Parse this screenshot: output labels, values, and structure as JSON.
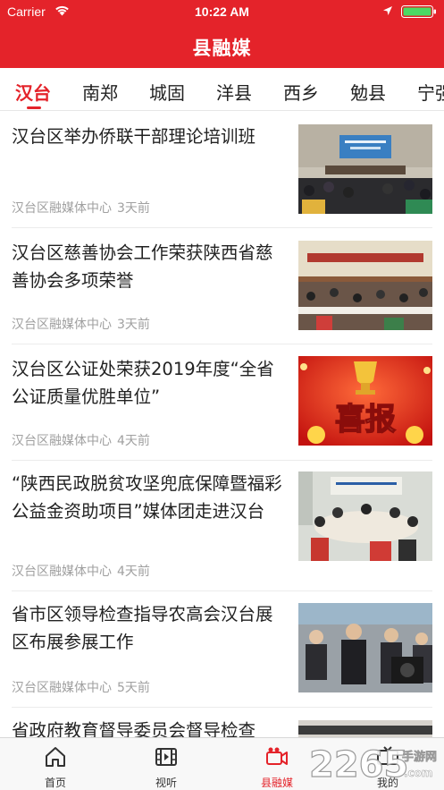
{
  "status_bar": {
    "carrier": "Carrier",
    "time": "10:22 AM"
  },
  "header": {
    "title": "县融媒"
  },
  "tabs": [
    {
      "label": "汉台",
      "active": true
    },
    {
      "label": "南郑",
      "active": false
    },
    {
      "label": "城固",
      "active": false
    },
    {
      "label": "洋县",
      "active": false
    },
    {
      "label": "西乡",
      "active": false
    },
    {
      "label": "勉县",
      "active": false
    },
    {
      "label": "宁强",
      "active": false
    }
  ],
  "news": [
    {
      "title": "汉台区举办侨联干部理论培训班",
      "source": "汉台区融媒体中心",
      "time": "3天前",
      "thumb": "meeting-hall-photo"
    },
    {
      "title": "汉台区慈善协会工作荣获陕西省慈善协会多项荣誉",
      "source": "汉台区融媒体中心",
      "time": "3天前",
      "thumb": "conference-photo"
    },
    {
      "title": "汉台区公证处荣获2019年度“全省公证质量优胜单位”",
      "source": "汉台区融媒体中心",
      "time": "4天前",
      "thumb": "xibao-banner",
      "thumb_text": "喜报"
    },
    {
      "title": "“陕西民政脱贫攻坚兜底保障暨福彩公益金资助项目”媒体团走进汉台",
      "source": "汉台区融媒体中心",
      "time": "4天前",
      "thumb": "round-table-meeting-photo"
    },
    {
      "title": "省市区领导检查指导农高会汉台展区布展参展工作",
      "source": "汉台区融媒体中心",
      "time": "5天前",
      "thumb": "officials-inspection-photo"
    },
    {
      "title": "省政府教育督导委员会督导检查",
      "source": "",
      "time": "",
      "thumb": "partial-photo"
    }
  ],
  "tabbar": [
    {
      "label": "首页",
      "icon": "home-icon",
      "active": false
    },
    {
      "label": "视听",
      "icon": "film-icon",
      "active": false
    },
    {
      "label": "县融媒",
      "icon": "camera-icon",
      "active": true
    },
    {
      "label": "我的",
      "icon": "tv-icon",
      "active": false
    }
  ],
  "watermark": {
    "number": "2265",
    "brand": "手游网",
    "domain": ".com"
  },
  "colors": {
    "brand_red": "#e4232a",
    "meta_gray": "#a0a0a0",
    "tabbar_bg": "#f8f8f8"
  }
}
